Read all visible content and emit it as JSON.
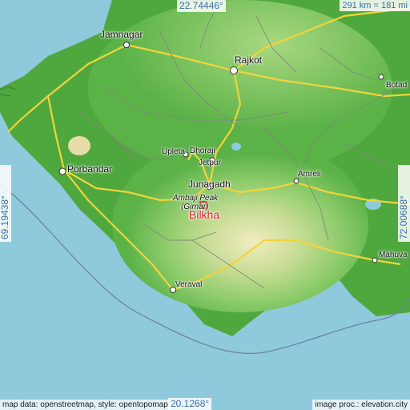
{
  "map": {
    "coords": {
      "top": "22.74446°",
      "bottom": "20.1268°",
      "left": "69.19438°",
      "right": "72.00688°"
    },
    "scale": "291 km = 181 mi",
    "footer": {
      "left": "map data: openstreetmap, style: opentopomap",
      "right": "image proc.: elevation.city"
    },
    "cities": {
      "jamnagar": "Jamnagar",
      "rajkot": "Rajkot",
      "botad": "Botad",
      "upleta": "Upleta",
      "dhoraji": "Dhoraji",
      "jetpur": "Jetpur",
      "porbandar": "Porbandar",
      "amreli": "Amreli",
      "junagadh": "Junagadh",
      "ambaji_peak": "Ambaji Peak",
      "girnar": "(Girnar)",
      "mahuva": "Mahuva",
      "veraval": "Veraval"
    },
    "target": "Bilkha",
    "colors": {
      "sea": "#8fc9dc",
      "lowland": "#4fa83d",
      "highland": "#e8e0a8",
      "target": "#d0202a"
    }
  }
}
